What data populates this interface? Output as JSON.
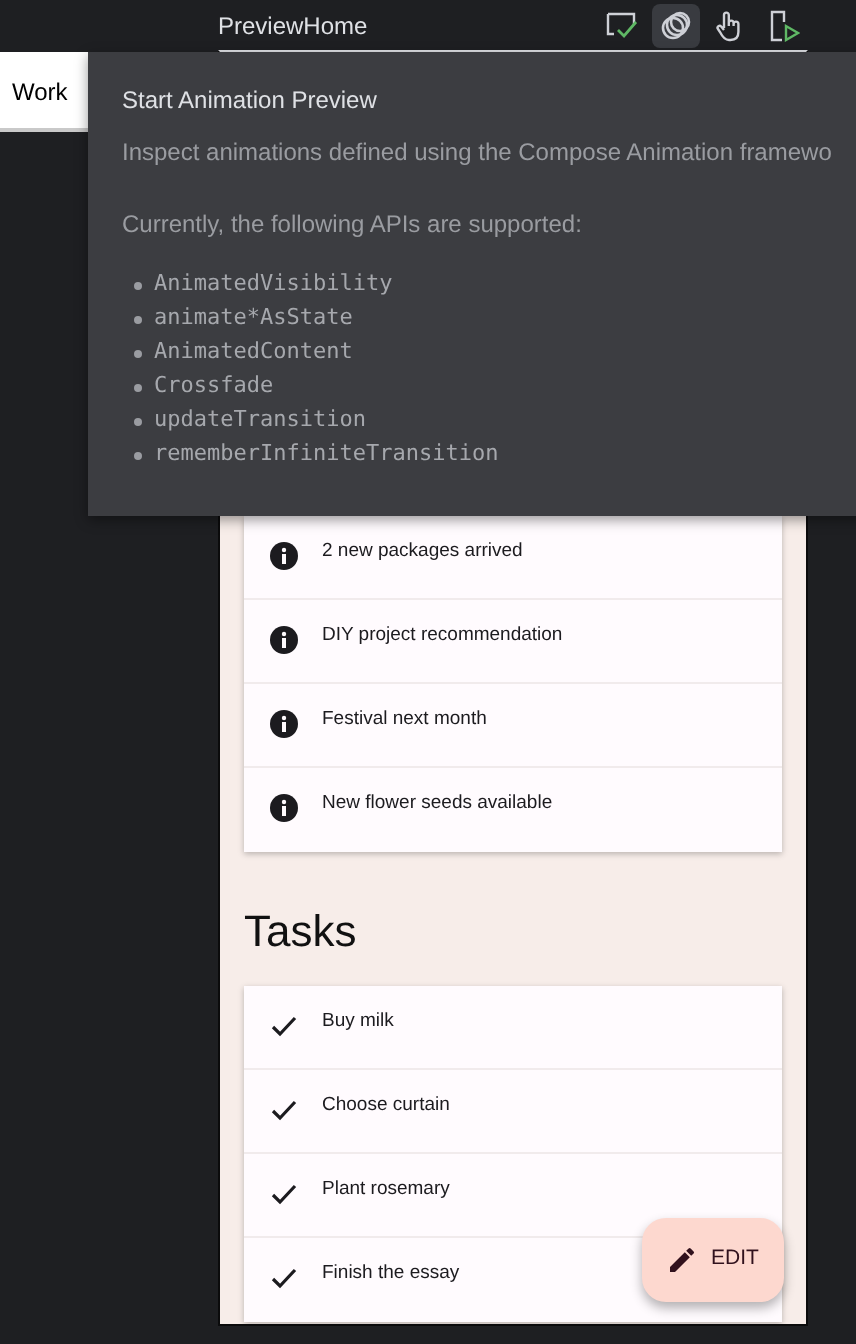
{
  "toolbar": {
    "title": "PreviewHome",
    "buttons": [
      {
        "kind": "check",
        "selected": false
      },
      {
        "kind": "rings",
        "selected": true
      },
      {
        "kind": "hand",
        "selected": false
      },
      {
        "kind": "run",
        "selected": false
      }
    ]
  },
  "side_tab": {
    "label": "Work"
  },
  "tooltip": {
    "title": "Start Animation Preview",
    "description": "Inspect animations defined using the Compose Animation framewo",
    "subtitle": "Currently, the following APIs are supported:",
    "apis": [
      "AnimatedVisibility",
      "animate*AsState",
      "AnimatedContent",
      "Crossfade",
      "updateTransition",
      "rememberInfiniteTransition"
    ]
  },
  "notifications": [
    {
      "text": "2 new packages arrived"
    },
    {
      "text": "DIY project recommendation"
    },
    {
      "text": "Festival next month"
    },
    {
      "text": "New flower seeds available"
    }
  ],
  "tasks": {
    "heading": "Tasks",
    "items": [
      {
        "text": "Buy milk",
        "done": true
      },
      {
        "text": "Choose curtain",
        "done": true
      },
      {
        "text": "Plant rosemary",
        "done": true
      },
      {
        "text": "Finish the essay",
        "done": true
      }
    ]
  },
  "fab": {
    "label": "EDIT"
  }
}
